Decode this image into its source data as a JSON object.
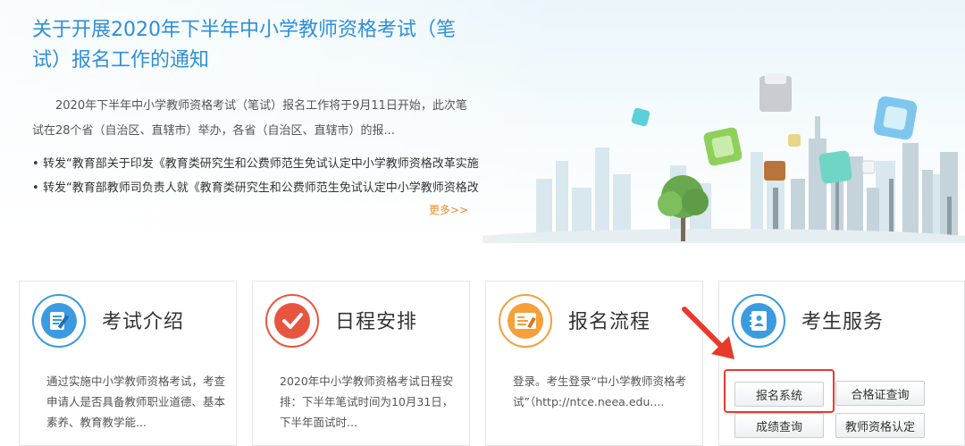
{
  "notice": {
    "title": "关于开展2020年下半年中小学教师资格考试（笔试）报名工作的通知",
    "summary": "2020年下半年中小学教师资格考试（笔试）报名工作将于9月11日开始，此次笔试在28个省（自治区、直辖市）举办，各省（自治区、直辖市）的报...",
    "links": [
      "转发“教育部关于印发《教育类研究生和公费师范生免试认定中小学教师资格改革实施...",
      "转发“教育部教师司负责人就《教育类研究生和公费师范生免试认定中小学教师资格改..."
    ],
    "more": "更多>>"
  },
  "cards": [
    {
      "title": "考试介绍",
      "text": "通过实施中小学教师资格考试，考查申请人是否具备教师职业道德、基本素养、教育教学能..."
    },
    {
      "title": "日程安排",
      "text": "2020年中小学教师资格考试日程安排：下半年笔试时间为10月31日，下半年面试时..."
    },
    {
      "title": "报名流程",
      "text": "登录。考生登录“中小学教师资格考试”（http://ntce.neea.edu...."
    },
    {
      "title": "考生服务"
    }
  ],
  "services": {
    "register": "报名系统",
    "certificate_query": "合格证查询",
    "score_query": "成绩查询",
    "qualification": "教师资格认定"
  },
  "colors": {
    "title_blue": "#2e8fd9",
    "more_orange": "#f08a24",
    "highlight_red": "#e83a2c",
    "icon_blue": "#3a9be0",
    "icon_red": "#e8553e",
    "icon_orange": "#f5a03a"
  },
  "icons": [
    "document-pen-icon",
    "checkmark-icon",
    "form-icon",
    "contacts-book-icon",
    "red-arrow-icon"
  ]
}
